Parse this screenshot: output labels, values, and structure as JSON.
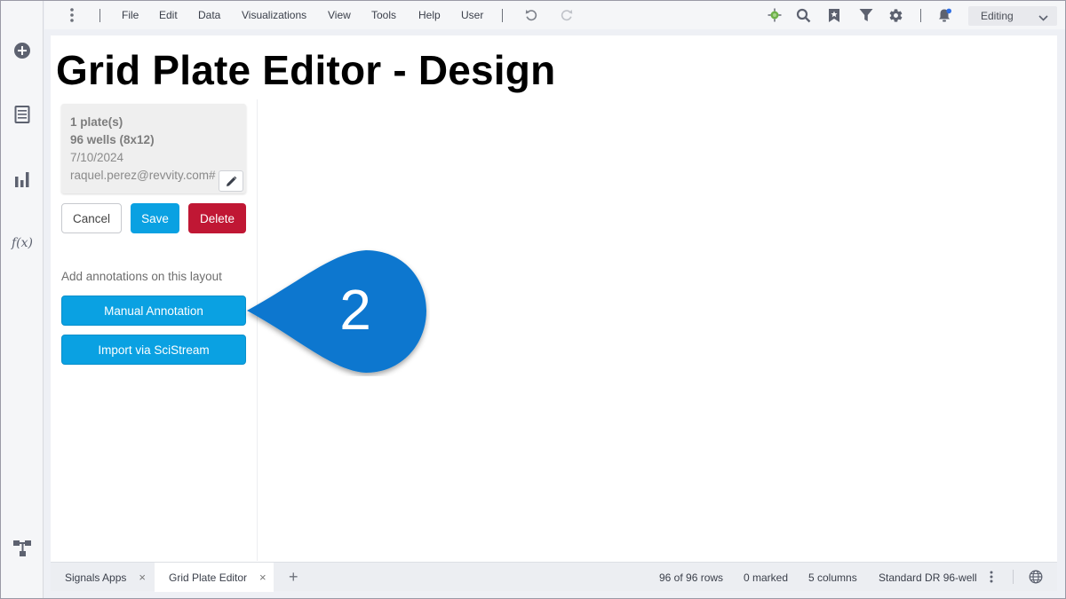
{
  "menubar": {
    "items": [
      "File",
      "Edit",
      "Data",
      "Visualizations",
      "View",
      "Tools",
      "Help",
      "User"
    ],
    "mode": "Editing"
  },
  "icons": {
    "rail": [
      "add-circle-icon",
      "document-list-icon",
      "bar-chart-icon",
      "function-icon",
      "flow-diagram-icon"
    ],
    "toolbar": [
      "menu-dots-icon",
      "undo-icon",
      "redo-icon",
      "extension-icon",
      "search-icon",
      "bookmark-icon",
      "filter-icon",
      "gear-icon",
      "notification-bell-icon",
      "chevron-down-icon"
    ]
  },
  "rail": {
    "function_glyph": "f(x)"
  },
  "page": {
    "title": "Grid Plate Editor - Design"
  },
  "card": {
    "plates": "1 plate(s)",
    "wells": "96 wells (8x12)",
    "date": "7/10/2024",
    "user": "raquel.perez@revvity.com#"
  },
  "buttons": {
    "cancel": "Cancel",
    "save": "Save",
    "delete": "Delete",
    "manual_annotation": "Manual Annotation",
    "import_scistream": "Import via SciStream"
  },
  "annotations": {
    "label": "Add annotations on this layout"
  },
  "callout": {
    "number": "2",
    "color": "#0a77cf"
  },
  "tabs": [
    {
      "label": "Signals Apps",
      "close": "×"
    },
    {
      "label": "Grid Plate Editor",
      "close": "×"
    }
  ],
  "tab_add": "+",
  "status": {
    "rows": "96 of 96 rows",
    "marked": "0 marked",
    "columns": "5 columns",
    "table": "Standard DR 96-well"
  },
  "colors": {
    "primary": "#0aa1e2",
    "danger": "#c01734",
    "callout": "#0a77cf"
  }
}
